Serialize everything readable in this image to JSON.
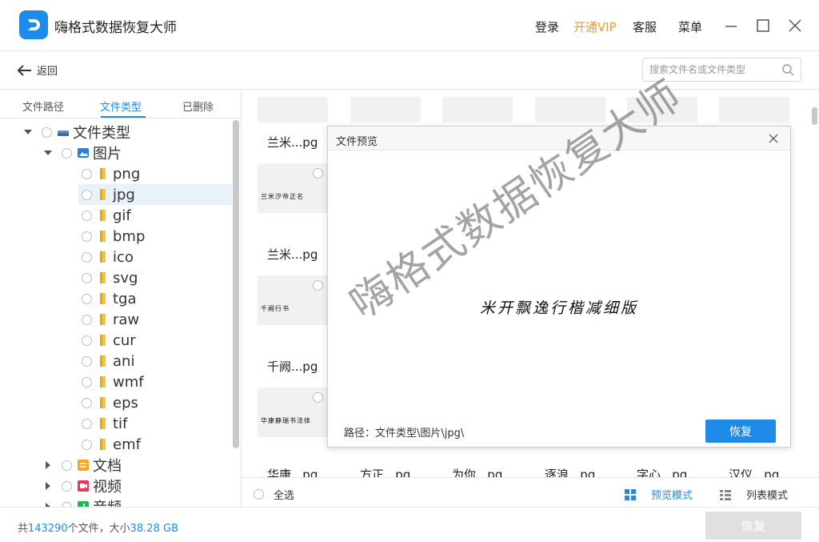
{
  "app": {
    "title": "嗨格式数据恢复大师",
    "links": {
      "login": "登录",
      "vip": "开通VIP",
      "service": "客服",
      "menu": "菜单"
    }
  },
  "nav": {
    "back_label": "返回",
    "search_placeholder": "搜索文件名或文件类型"
  },
  "tabs": [
    {
      "label": "文件路径"
    },
    {
      "label": "文件类型"
    },
    {
      "label": "已删除"
    }
  ],
  "tree": {
    "root": "文件类型",
    "images": "图片",
    "image_types": [
      "png",
      "jpg",
      "gif",
      "bmp",
      "ico",
      "svg",
      "tga",
      "raw",
      "cur",
      "ani",
      "wmf",
      "eps",
      "tif",
      "emf"
    ],
    "docs": "文档",
    "video": "视频",
    "audio": "音频"
  },
  "grid": {
    "rows": [
      {
        "name": "兰米...pg"
      },
      {
        "name": "兰米...pg",
        "thumb_text": "兰米汐帝正名"
      },
      {
        "name": "千阙...pg",
        "thumb_text": "千阙行书"
      },
      {
        "name": "",
        "thumb_text": "华康静瑞书法体"
      }
    ],
    "bottom_names": [
      "华康...pg",
      "方正...pg",
      "为你...pg",
      "逐浪...pg",
      "字心...pg",
      "汉仪...pg"
    ]
  },
  "gridbar": {
    "select_all": "全选",
    "preview_mode": "预览模式",
    "list_mode": "列表模式"
  },
  "status": {
    "prefix": "共",
    "file_count": "143290",
    "mid": "个文件，大小",
    "size": "38.28 GB",
    "recover": "恢复"
  },
  "dialog": {
    "title": "文件预览",
    "image_text": "米开飘逸行楷减细版",
    "path": "路径：文件类型\\图片\\jpg\\",
    "recover": "恢复"
  },
  "watermark": "嗨格式数据恢复大师",
  "colors": {
    "accent": "#1e8be8",
    "vip": "#f29b1e",
    "disabled": "#e0e0e0"
  }
}
